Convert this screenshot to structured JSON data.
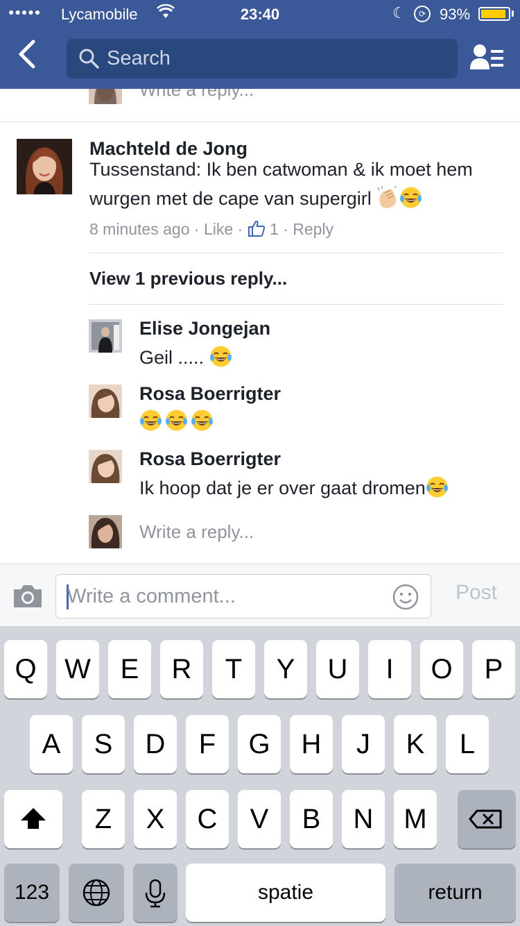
{
  "status_bar": {
    "signal": "●●●●●",
    "carrier": "Lycamobile",
    "time": "23:40",
    "battery_percent": "93%",
    "battery_level": 0.93,
    "battery_color": "#ffcc00"
  },
  "header": {
    "search_placeholder": "Search",
    "bg_color": "#3b5998"
  },
  "previous_reply_strip": {
    "text": "Write a reply..."
  },
  "comment": {
    "author": "Machteld de Jong",
    "text": "Tussenstand: Ik ben catwoman & ik moet hem wurgen met de cape van supergirl",
    "emojis": [
      "clapping-hands-light-skin-tone",
      "face-with-tears-of-joy"
    ],
    "time": "8 minutes ago",
    "like_label": "Like",
    "like_count": "1",
    "reply_label": "Reply",
    "separator": "·"
  },
  "view_previous": "View 1 previous reply...",
  "replies": [
    {
      "author": "Elise Jongejan",
      "text": "Geil ..... ",
      "emojis": [
        "face-with-tears-of-joy"
      ]
    },
    {
      "author": "Rosa Boerrigter",
      "text": "",
      "emojis": [
        "face-with-tears-of-joy",
        "face-with-tears-of-joy",
        "face-with-tears-of-joy"
      ]
    },
    {
      "author": "Rosa Boerrigter",
      "text": "Ik hoop dat je er over gaat dromen",
      "emojis": [
        "face-with-tears-of-joy"
      ]
    }
  ],
  "write_reply_placeholder": "Write a reply...",
  "composer": {
    "placeholder": "Write a comment...",
    "post_label": "Post"
  },
  "keyboard": {
    "row1": [
      "Q",
      "W",
      "E",
      "R",
      "T",
      "Y",
      "U",
      "I",
      "O",
      "P"
    ],
    "row2": [
      "A",
      "S",
      "D",
      "F",
      "G",
      "H",
      "J",
      "K",
      "L"
    ],
    "row3": [
      "Z",
      "X",
      "C",
      "V",
      "B",
      "N",
      "M"
    ],
    "numbers_label": "123",
    "space_label": "spatie",
    "return_label": "return"
  }
}
